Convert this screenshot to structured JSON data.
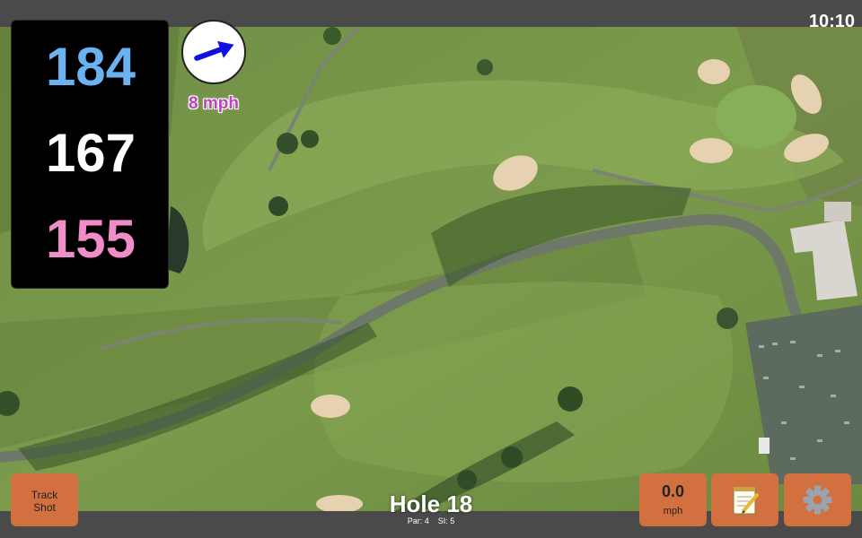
{
  "status_bar": {
    "time": "10:10"
  },
  "distances": {
    "back": "184",
    "middle": "167",
    "front": "155"
  },
  "colors": {
    "back": "#6ab2f2",
    "middle": "#ffffff",
    "front": "#f08cc8",
    "wind_arrow": "#1010e0",
    "wind_text": "#c040c0",
    "button": "#d2703f"
  },
  "wind": {
    "speed_text": "8 mph",
    "direction_icon": "arrow-right-icon"
  },
  "buttons": {
    "track_shot": {
      "line1": "Track",
      "line2": "Shot"
    },
    "speed": {
      "value": "0.0",
      "unit": "mph"
    },
    "notes": {
      "icon": "notepad-icon"
    },
    "settings": {
      "icon": "gear-icon"
    }
  },
  "hole": {
    "title": "Hole 18",
    "par": "Par: 4",
    "si": "SI: 5"
  }
}
